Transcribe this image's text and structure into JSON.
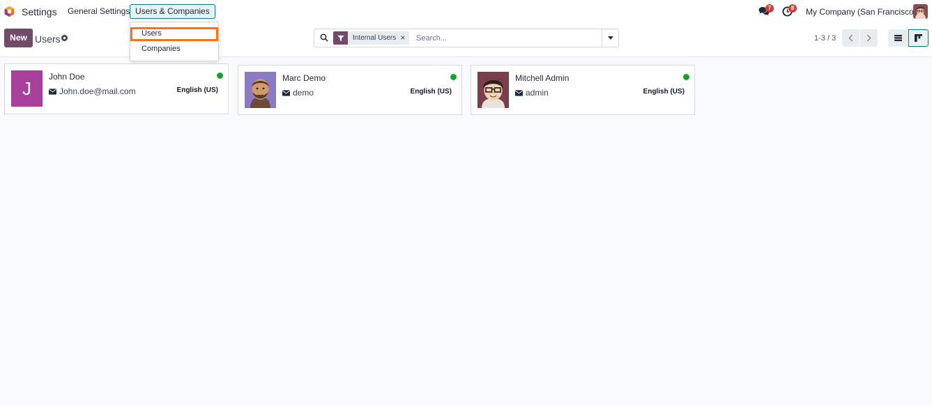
{
  "navbar": {
    "app_name": "Settings",
    "menu": [
      "General Settings",
      "Users & Companies"
    ],
    "chat_count": "7",
    "activity_count": "8",
    "company": "My Company (San Francisco)"
  },
  "dropdown": {
    "items": [
      "Users",
      "Companies"
    ]
  },
  "control_panel": {
    "new_label": "New",
    "title": "Users",
    "facet_label": "Internal Users",
    "facet_close": "×",
    "search_placeholder": "Search...",
    "pager": "1-3 / 3"
  },
  "cards": [
    {
      "name": "John Doe",
      "login": "John.doe@mail.com",
      "lang": "English (US)",
      "avatar_letter": "J"
    },
    {
      "name": "Marc Demo",
      "login": "demo",
      "lang": "English (US)"
    },
    {
      "name": "Mitchell Admin",
      "login": "admin",
      "lang": "English (US)"
    }
  ],
  "colors": {
    "brand": "#714b67",
    "active_border": "#017e84",
    "highlight": "#f97316",
    "online": "#17a02c",
    "badge": "#d23f3a"
  }
}
